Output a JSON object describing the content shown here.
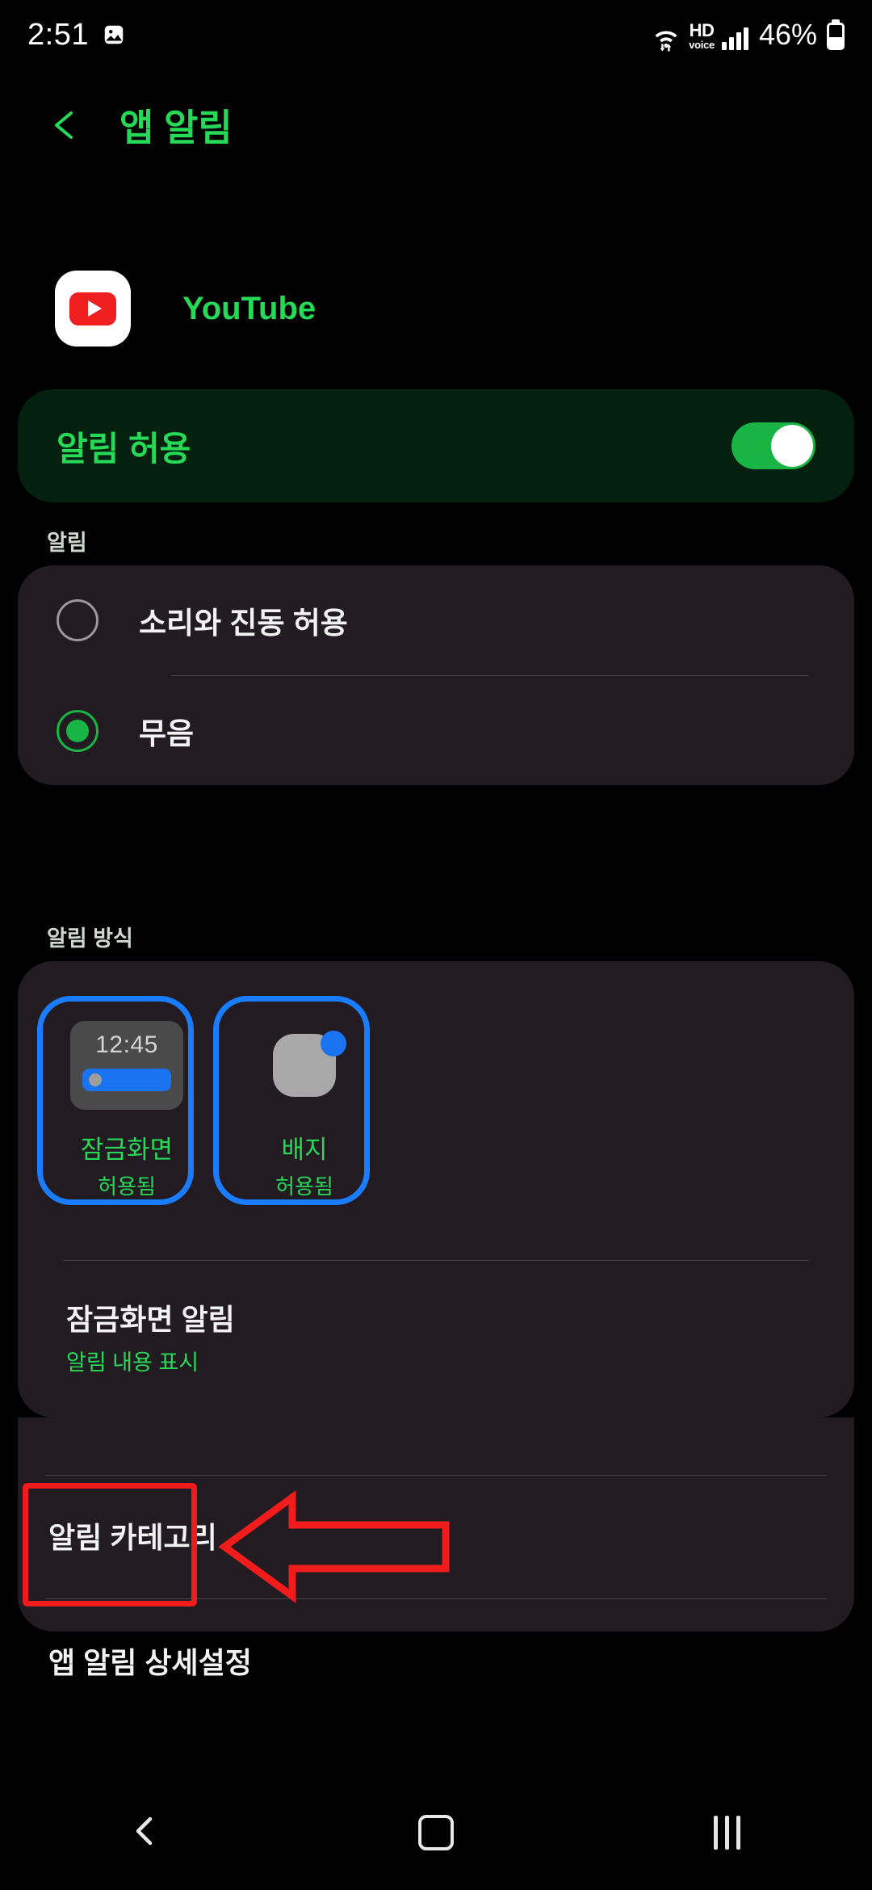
{
  "status_bar": {
    "time": "2:51",
    "photo_icon": "image-icon",
    "wifi_icon": "wifi-data-icon",
    "hd_line1": "HD",
    "hd_line2": "voice",
    "signal_icon": "signal-bars-icon",
    "battery_percent": "46%",
    "battery_icon": "battery-icon"
  },
  "app_bar": {
    "back_icon": "back-chevron-icon",
    "title": "앱 알림"
  },
  "app_header": {
    "icon": "youtube-icon",
    "name": "YouTube"
  },
  "allow_card": {
    "label": "알림 허용",
    "toggle_state": "on"
  },
  "notification_section": {
    "header": "알림",
    "options": [
      {
        "label": "소리와 진동 허용",
        "selected": false
      },
      {
        "label": "무음",
        "selected": true
      }
    ]
  },
  "method_section": {
    "header": "알림 방식",
    "tiles": [
      {
        "preview": "lock-screen-preview",
        "preview_time": "12:45",
        "title": "잠금화면",
        "state": "허용됨",
        "highlighted": true
      },
      {
        "preview": "badge-preview",
        "title": "배지",
        "state": "허용됨",
        "highlighted": true
      }
    ],
    "items": [
      {
        "title": "잠금화면 알림",
        "subtitle": "알림 내용 표시"
      },
      {
        "title": "알림 카테고리",
        "subtitle": ""
      },
      {
        "title": "앱 알림 상세설정",
        "subtitle": ""
      }
    ]
  },
  "annotations": {
    "blue_outline_color": "#1a7cff",
    "red_outline_color": "#f01b1b",
    "red_arrow_direction": "left",
    "highlighted_item": "알림 카테고리"
  },
  "nav_bar": {
    "back_icon": "nav-back-icon",
    "home_icon": "nav-home-icon",
    "recents_icon": "nav-recents-icon"
  },
  "colors": {
    "accent_green": "#26d957",
    "toggle_green": "#18b544",
    "card_dark": "#221c22",
    "card_green": "#04200e",
    "background": "#000000",
    "blue": "#1a73f0",
    "youtube_red": "#ef1f1f"
  }
}
